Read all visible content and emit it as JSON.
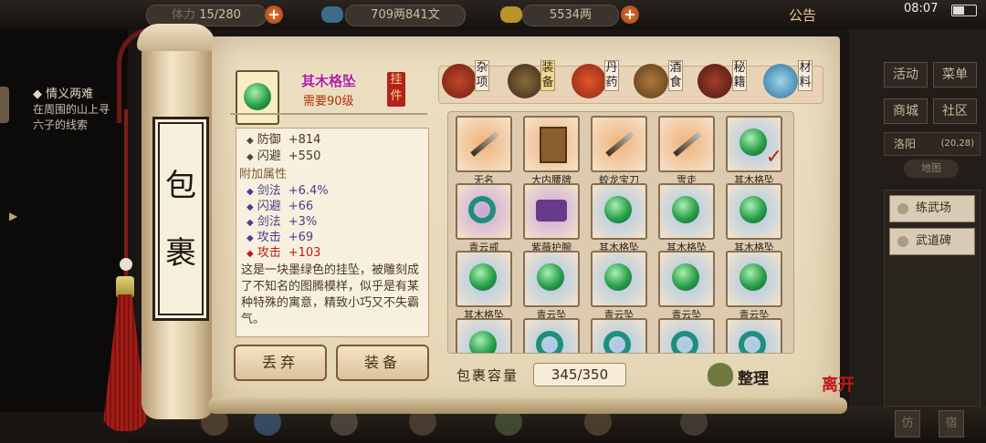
{
  "topbar": {
    "stamina": "15/280",
    "stamina_prefix": "体力",
    "money": "709两841文",
    "silver": "5534两",
    "notice": "公告",
    "time": "08:07"
  },
  "left_quest": {
    "title": "◆ 情义两难",
    "text": "在周围的山上寻\n六子的线索"
  },
  "right_menu": {
    "buttons": [
      "活动",
      "菜单",
      "商城",
      "社区"
    ],
    "city": "洛阳",
    "coords": "(20,28)",
    "map_btn": "地图",
    "places": [
      "练武场",
      "武道碑"
    ]
  },
  "scroll": {
    "chars": [
      "包",
      "裹"
    ]
  },
  "selected_item": {
    "name": "其木格坠",
    "requirement": "需要90级",
    "tag": "挂件",
    "base_stats": [
      {
        "label": "防御",
        "value": "+814"
      },
      {
        "label": "闪避",
        "value": "+550"
      }
    ],
    "extra_title": "附加属性",
    "extra_stats": [
      {
        "label": "剑法",
        "value": "+6.4%",
        "color": "purple"
      },
      {
        "label": "闪避",
        "value": "+66",
        "color": "purple"
      },
      {
        "label": "剑法",
        "value": "+3%",
        "color": "purple"
      },
      {
        "label": "攻击",
        "value": "+69",
        "color": "purple"
      },
      {
        "label": "攻击",
        "value": "+103",
        "color": "red"
      }
    ],
    "description": "这是一块墨绿色的挂坠，被雕刻成了不知名的图腾模样，似乎是有某种特殊的寓意，精致小巧又不失霸气。"
  },
  "actions": {
    "discard": "丢弃",
    "equip": "装备"
  },
  "categories": [
    {
      "label": "杂项",
      "icon": "pot-icon"
    },
    {
      "label": "装备",
      "icon": "weapons-icon"
    },
    {
      "label": "丹药",
      "icon": "pills-icon"
    },
    {
      "label": "酒食",
      "icon": "wine-food-icon"
    },
    {
      "label": "秘籍",
      "icon": "books-icon"
    },
    {
      "label": "材料",
      "icon": "crystal-icon"
    }
  ],
  "items": [
    {
      "name": "无名",
      "icon": "sword"
    },
    {
      "name": "大内腰牌",
      "icon": "plaque"
    },
    {
      "name": "蛟龙宝刀",
      "icon": "sword"
    },
    {
      "name": "雪走",
      "icon": "sword"
    },
    {
      "name": "其木格坠",
      "icon": "jade",
      "checked": true
    },
    {
      "name": "青云戒",
      "icon": "ring"
    },
    {
      "name": "紫薇护腕",
      "icon": "wrist"
    },
    {
      "name": "其木格坠",
      "icon": "jade"
    },
    {
      "name": "其木格坠",
      "icon": "jade"
    },
    {
      "name": "其木格坠",
      "icon": "jade"
    },
    {
      "name": "其木格坠",
      "icon": "jade"
    },
    {
      "name": "青云坠",
      "icon": "jade"
    },
    {
      "name": "青云坠",
      "icon": "jade"
    },
    {
      "name": "青云坠",
      "icon": "jade"
    },
    {
      "name": "青云坠",
      "icon": "jade"
    },
    {
      "name": "",
      "icon": "jade"
    },
    {
      "name": "",
      "icon": "ring"
    },
    {
      "name": "",
      "icon": "ring"
    },
    {
      "name": "",
      "icon": "ring"
    },
    {
      "name": "",
      "icon": "ring"
    }
  ],
  "capacity": {
    "label": "包裹容量",
    "value": "345/350"
  },
  "sort_label": "整理",
  "leave_label": "离开"
}
